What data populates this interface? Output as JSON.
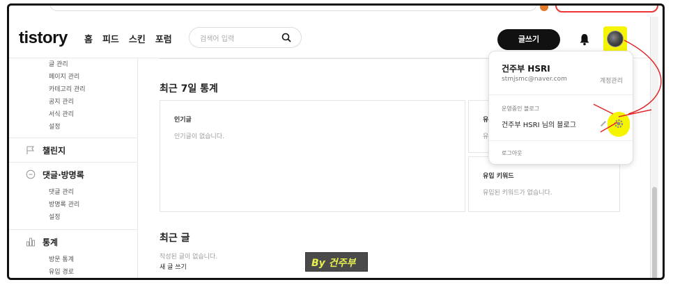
{
  "header": {
    "logo": "tistory",
    "nav": [
      "홈",
      "피드",
      "스킨",
      "포럼"
    ],
    "search_placeholder": "검색어 입력",
    "write_button": "글쓰기"
  },
  "sidebar": {
    "content_items": [
      "글 관리",
      "페이지 관리",
      "카테고리 관리",
      "공지 관리",
      "서식 관리",
      "설정"
    ],
    "groups": [
      {
        "title": "챌린지",
        "icon": "flag-icon",
        "items": []
      },
      {
        "title": "댓글·방명록",
        "icon": "comment-icon",
        "items": [
          "댓글 관리",
          "방명록 관리",
          "설정"
        ]
      },
      {
        "title": "통계",
        "icon": "chart-icon",
        "items": [
          "방문 통계",
          "유입 경로"
        ]
      }
    ]
  },
  "main": {
    "stats_title": "최근 7일 통계",
    "popular": {
      "title": "인기글",
      "empty": "인기글이 없습니다."
    },
    "inflow": {
      "title": "유",
      "empty": "유"
    },
    "keywords": {
      "title": "유입 키워드",
      "empty": "유입된 키워드가 없습니다."
    },
    "recent_title": "최근 글",
    "recent_empty": "작성된 글이 없습니다.",
    "recent_new": "새 글 쓰기"
  },
  "dropdown": {
    "name": "건주부 HSRI",
    "email": "stmjsmc@naver.com",
    "account_manage": "계정관리",
    "section_label": "운영중인 블로그",
    "blog_name": "건주부 HSRI 님의 블로그",
    "logout": "로그아웃"
  },
  "watermark": "By 건주부",
  "colors": {
    "highlight": "#f5f500",
    "annotation": "#e32424",
    "dark": "#111111"
  }
}
